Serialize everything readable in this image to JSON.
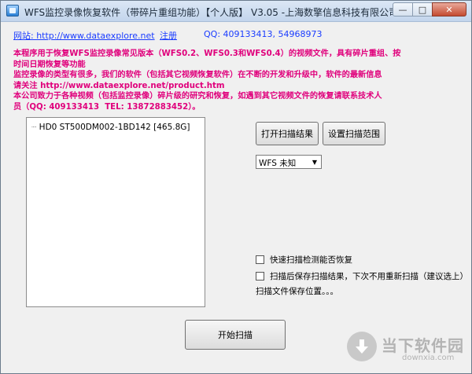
{
  "window": {
    "title": "WFS监控录像恢复软件（带碎片重组功能）【个人版】 V3.05  -上海数擎信息科技有限公司-",
    "controls": {
      "minimize": "—",
      "maximize": "□",
      "close": "✕"
    }
  },
  "header": {
    "website_label": "网站: http://www.dataexplore.net",
    "register_label": "注册",
    "qq_label": "QQ: 409133413, 54968973"
  },
  "description": {
    "lines": [
      "本程序用于恢复WFS监控录像常见版本（WFS0.2、WFS0.3和WFS0.4）的视频文件，具有碎片重组、按",
      "时间日期恢复等功能",
      "监控录像的类型有很多，我们的软件（包括其它视频恢复软件）在不断的开发和升级中，软件的最新信息",
      "请关注 http://www.dataexplore.net/product.htm",
      "本公司致力于各种视频（包括监控录像）碎片级的研究和恢复，如遇到其它视频文件的恢复请联系技术人",
      "员（QQ: 409133413  TEL: 13872883452）。"
    ],
    "color": "#e0007c"
  },
  "disk_tree": {
    "items": [
      {
        "label": "HD0  ST500DM002-1BD142  [465.8G]"
      }
    ]
  },
  "buttons": {
    "open_scan_result": "打开扫描结果",
    "set_scan_range": "设置扫描范围",
    "start_scan": "开始扫描"
  },
  "version_select": {
    "value": "WFS 未知"
  },
  "options": {
    "fast_scan": {
      "label": "快速扫描检测能否恢复",
      "checked": false
    },
    "save_after_scan": {
      "label": "扫描后保存扫描结果，下次不用重新扫描（建议选上）",
      "checked": false
    },
    "save_path_label": "扫描文件保存位置。。。"
  },
  "watermark": {
    "name": "当下软件园",
    "domain": "downxia.com",
    "icon": "download-arrow-icon"
  }
}
